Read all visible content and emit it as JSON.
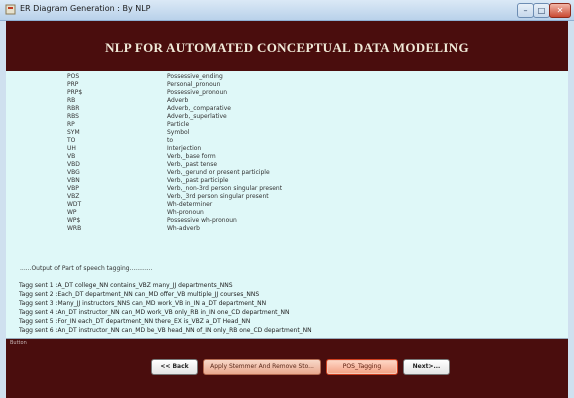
{
  "window": {
    "title": "ER Diagram Generation : By NLP",
    "controls": [
      "minimize",
      "maximize",
      "close"
    ]
  },
  "header": {
    "title": "NLP FOR AUTOMATED CONCEPTUAL DATA MODELING"
  },
  "pos_tags": [
    {
      "code": "POS",
      "description": "Possessive_ending"
    },
    {
      "code": "PRP",
      "description": "Personal_pronoun"
    },
    {
      "code": "PRP$",
      "description": "Possessive_pronoun"
    },
    {
      "code": "RB",
      "description": "Adverb"
    },
    {
      "code": "RBR",
      "description": "Adverb,_comparative"
    },
    {
      "code": "RBS",
      "description": "Adverb,_superlative"
    },
    {
      "code": "RP",
      "description": "Particle"
    },
    {
      "code": "SYM",
      "description": "Symbol"
    },
    {
      "code": "TO",
      "description": "to"
    },
    {
      "code": "UH",
      "description": "Interjection"
    },
    {
      "code": "VB",
      "description": "Verb,_base form"
    },
    {
      "code": "VBD",
      "description": "Verb,_past tense"
    },
    {
      "code": "VBG",
      "description": "Verb,_gerund or present participle"
    },
    {
      "code": "VBN",
      "description": "Verb,_past participle"
    },
    {
      "code": "VBP",
      "description": "Verb,_non-3rd person singular present"
    },
    {
      "code": "VBZ",
      "description": "Verb,_3rd person singular present"
    },
    {
      "code": "WDT",
      "description": "Wh-determiner"
    },
    {
      "code": "WP",
      "description": "Wh-pronoun"
    },
    {
      "code": "WP$",
      "description": "Possessive wh-pronoun"
    },
    {
      "code": "WRB",
      "description": "Wh-adverb"
    }
  ],
  "output_label": "......Output of Part of speech tagging............",
  "tagged_sentences": [
    "Tagg sent 1 :A_DT college_NN contains_VBZ many_JJ departments_NNS",
    "Tagg sent 2 :Each_DT department_NN can_MD offer_VB multiple_JJ courses_NNS",
    "Tagg sent 3 :Many_JJ instructors_NNS can_MD work_VB in_IN a_DT department_NN",
    "Tagg sent 4 :An_DT instructor_NN can_MD work_VB only_RB in_IN one_CD department_NN",
    "Tagg sent 5 :For_IN each_DT department_NN there_EX is_VBZ a_DT Head_NN",
    "Tagg sent 6 :An_DT instructor_NN can_MD be_VB head_NN of_IN only_RB one_CD department_NN"
  ],
  "bottom": {
    "section_label": "Button",
    "buttons": {
      "back": "<< Back",
      "stemmer": "Apply Stemmer And Remove Sto...",
      "pos_tagging": "POS_Tagging",
      "next": "Next>..."
    }
  },
  "colors": {
    "header_bg": "#4a0d0d",
    "content_bg": "#dff8f8",
    "heading_text": "#f0ead8"
  }
}
